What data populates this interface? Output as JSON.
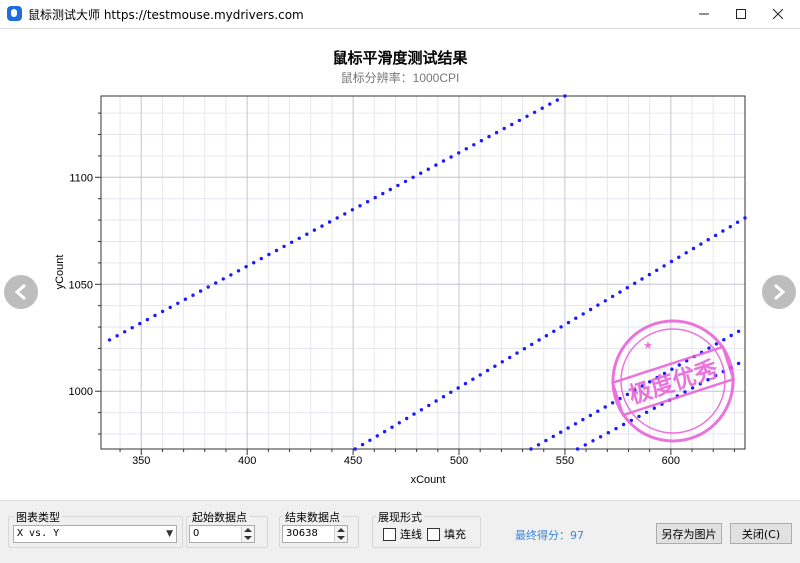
{
  "window": {
    "title": "鼠标测试大师 https://testmouse.mydrivers.com",
    "min_icon": "minimize-icon",
    "max_icon": "maximize-icon",
    "close_icon": "close-icon"
  },
  "chart_data": {
    "type": "scatter",
    "title": "鼠标平滑度测试结果",
    "subtitle": "鼠标分辨率：1000CPI",
    "xlabel": "xCount",
    "ylabel": "yCount",
    "xlim": [
      331,
      635
    ],
    "ylim": [
      973,
      1138
    ],
    "xticks": [
      350,
      400,
      450,
      500,
      550,
      600
    ],
    "yticks": [
      1000,
      1050,
      1100
    ],
    "grid": true,
    "point_color": "#1a1aff",
    "series": [
      {
        "x": [
          335,
          550
        ],
        "y": [
          1024,
          1138
        ]
      },
      {
        "x": [
          451,
          635
        ],
        "y": [
          973,
          1081
        ]
      },
      {
        "x": [
          534,
          632
        ],
        "y": [
          973,
          1028
        ]
      },
      {
        "x": [
          556,
          632
        ],
        "y": [
          973,
          1013
        ]
      }
    ]
  },
  "stamp": {
    "text": "极度优秀",
    "color": "#e85bd7"
  },
  "controls": {
    "chart_type_label": "图表类型",
    "chart_type_value": "X vs. Y",
    "start_point_label": "起始数据点",
    "start_point_value": "0",
    "end_point_label": "结束数据点",
    "end_point_value": "30638",
    "display_label": "展现形式",
    "line_label": "连线",
    "fill_label": "填充",
    "score_text": "最终得分：97",
    "save_image_label": "另存为图片",
    "close_label": "关闭(C)"
  },
  "nav": {
    "prev_icon": "chevron-left-icon",
    "next_icon": "chevron-right-icon"
  }
}
